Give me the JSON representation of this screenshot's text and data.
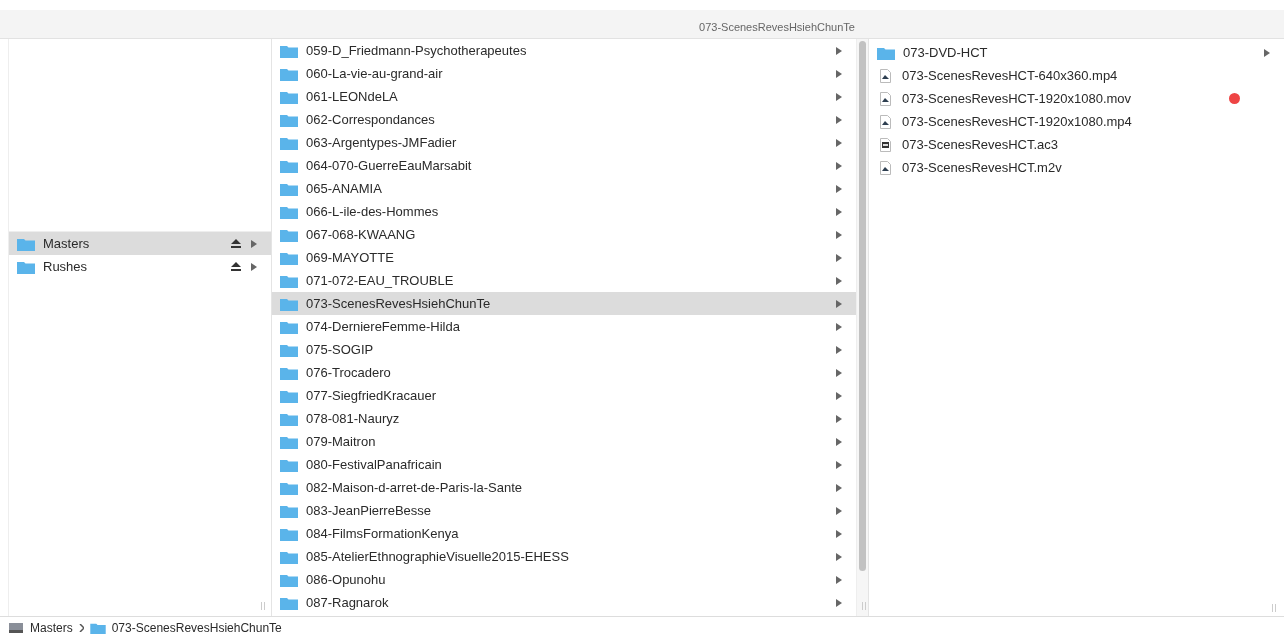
{
  "window": {
    "title": "073-ScenesRevesHsiehChunTe"
  },
  "sidebar": {
    "items": [
      {
        "label": "Masters",
        "selected": true
      },
      {
        "label": "Rushes",
        "selected": false
      }
    ]
  },
  "folders": {
    "items": [
      {
        "name": "059-D_Friedmann-Psychotherapeutes",
        "selected": false
      },
      {
        "name": "060-La-vie-au-grand-air",
        "selected": false
      },
      {
        "name": "061-LEONdeLA",
        "selected": false
      },
      {
        "name": "062-Correspondances",
        "selected": false
      },
      {
        "name": "063-Argentypes-JMFadier",
        "selected": false
      },
      {
        "name": "064-070-GuerreEauMarsabit",
        "selected": false
      },
      {
        "name": "065-ANAMIA",
        "selected": false
      },
      {
        "name": "066-L-ile-des-Hommes",
        "selected": false
      },
      {
        "name": "067-068-KWAANG",
        "selected": false
      },
      {
        "name": "069-MAYOTTE",
        "selected": false
      },
      {
        "name": "071-072-EAU_TROUBLE",
        "selected": false
      },
      {
        "name": "073-ScenesRevesHsiehChunTe",
        "selected": true
      },
      {
        "name": "074-DerniereFemme-Hilda",
        "selected": false
      },
      {
        "name": "075-SOGIP",
        "selected": false
      },
      {
        "name": "076-Trocadero",
        "selected": false
      },
      {
        "name": "077-SiegfriedKracauer",
        "selected": false
      },
      {
        "name": "078-081-Nauryz",
        "selected": false
      },
      {
        "name": "079-Maitron",
        "selected": false
      },
      {
        "name": "080-FestivalPanafricain",
        "selected": false
      },
      {
        "name": "082-Maison-d-arret-de-Paris-la-Sante",
        "selected": false
      },
      {
        "name": "083-JeanPierreBesse",
        "selected": false
      },
      {
        "name": "084-FilmsFormationKenya",
        "selected": false
      },
      {
        "name": "085-AtelierEthnographieVisuelle2015-EHESS",
        "selected": false
      },
      {
        "name": "086-Opunohu",
        "selected": false
      },
      {
        "name": "087-Ragnarok",
        "selected": false
      }
    ]
  },
  "contents": {
    "items": [
      {
        "name": "073-DVD-HCT",
        "kind": "folder"
      },
      {
        "name": "073-ScenesRevesHCT-640x360.mp4",
        "kind": "video"
      },
      {
        "name": "073-ScenesRevesHCT-1920x1080.mov",
        "kind": "video",
        "color": "#ee4444"
      },
      {
        "name": "073-ScenesRevesHCT-1920x1080.mp4",
        "kind": "video"
      },
      {
        "name": "073-ScenesRevesHCT.ac3",
        "kind": "audio"
      },
      {
        "name": "073-ScenesRevesHCT.m2v",
        "kind": "video"
      }
    ]
  },
  "path_bar": {
    "items": [
      {
        "label": "Masters",
        "kind": "drive"
      },
      {
        "label": "073-ScenesRevesHsiehChunTe",
        "kind": "folder"
      }
    ]
  }
}
